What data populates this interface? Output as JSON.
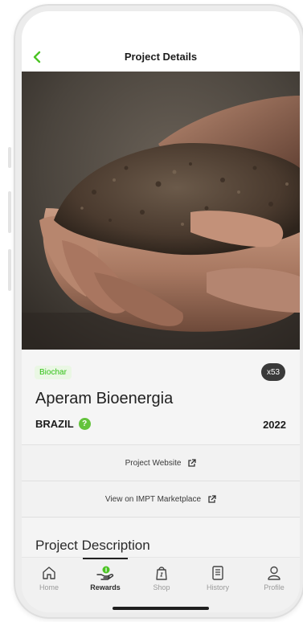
{
  "header": {
    "title": "Project Details",
    "back_icon": "chevron-left-icon"
  },
  "hero": {
    "description": "soil-in-hands-photo"
  },
  "project": {
    "tag": "Biochar",
    "count_badge": "x53",
    "name": "Aperam Bioenergia",
    "country": "BRAZIL",
    "help_icon_glyph": "?",
    "year": "2022"
  },
  "links": {
    "website_label": "Project Website",
    "marketplace_label": "View on IMPT Marketplace"
  },
  "section": {
    "description_title": "Project Description"
  },
  "tabs": [
    {
      "label": "Home",
      "icon": "home-icon"
    },
    {
      "label": "Rewards",
      "icon": "rewards-icon"
    },
    {
      "label": "Shop",
      "icon": "shop-icon"
    },
    {
      "label": "History",
      "icon": "history-icon"
    },
    {
      "label": "Profile",
      "icon": "profile-icon"
    }
  ],
  "active_tab": "Rewards",
  "colors": {
    "accent": "#4cc424",
    "tag_bg": "#eaf7e4",
    "badge_bg": "#3a3a3a"
  }
}
